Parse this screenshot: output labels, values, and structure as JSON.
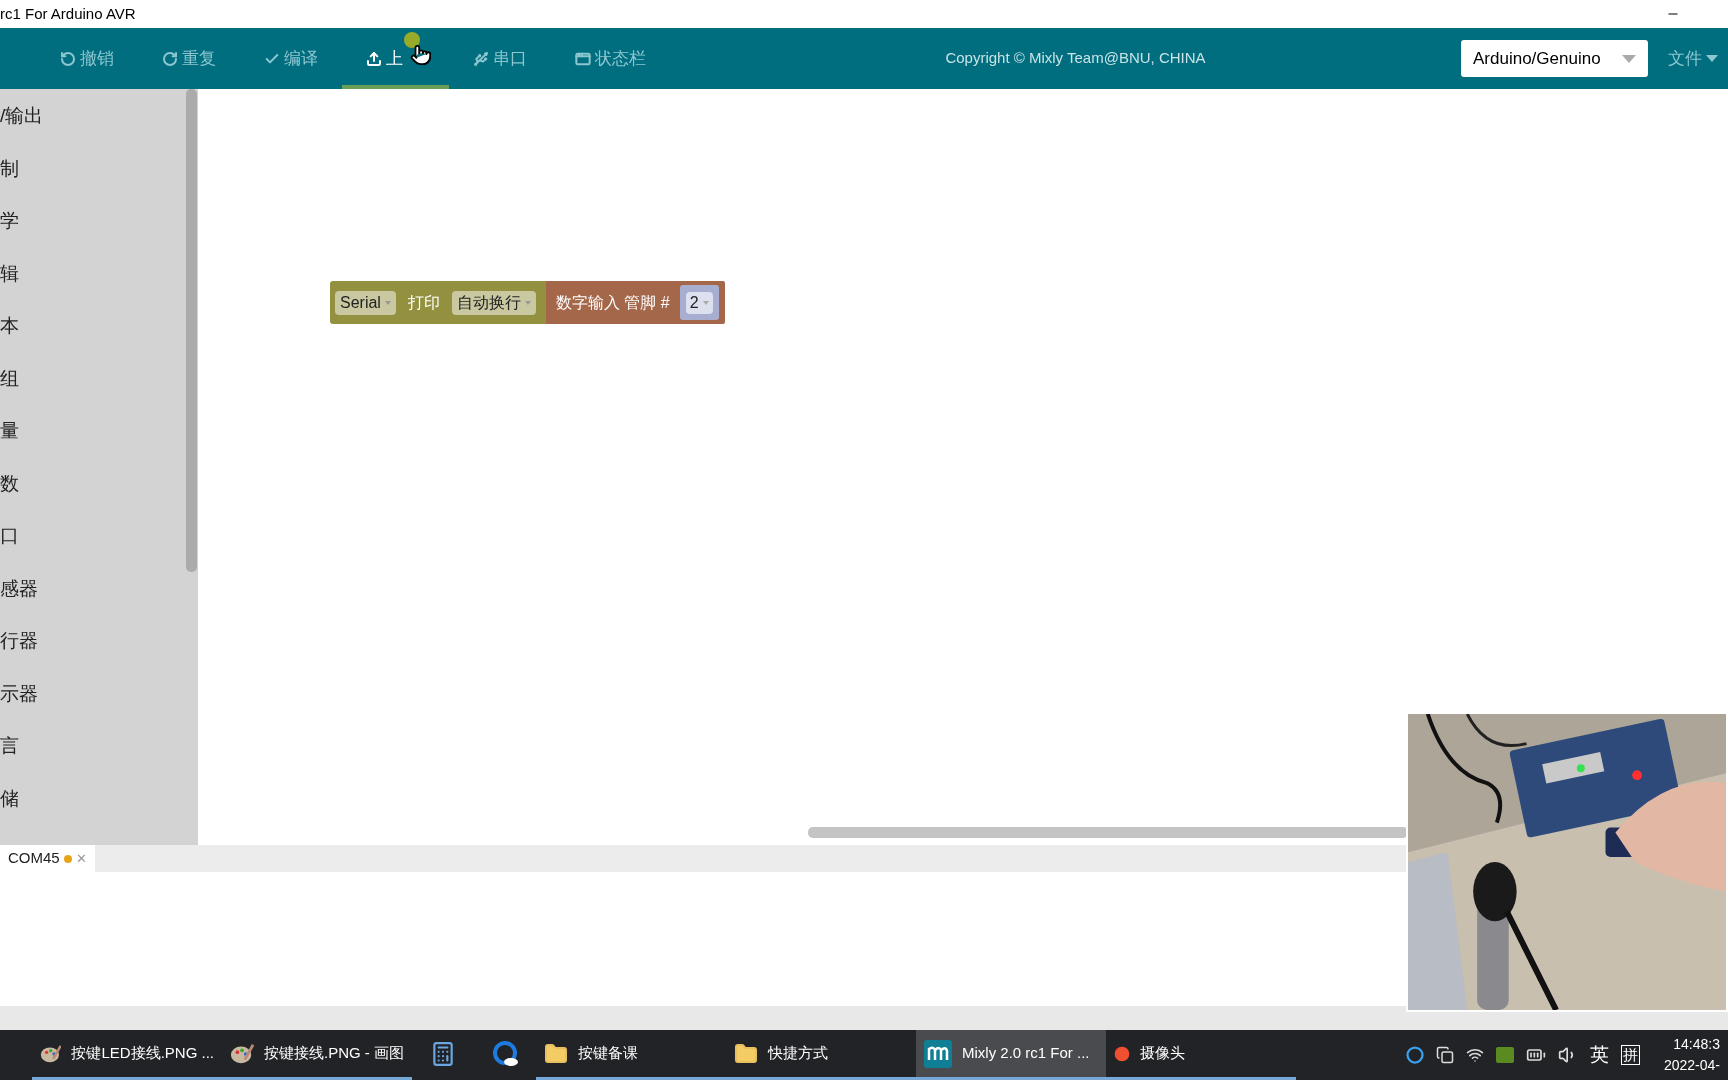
{
  "window": {
    "title": "rc1 For Arduino AVR"
  },
  "toolbar": {
    "items": [
      {
        "kind": "undo",
        "label": "撤销",
        "selected": false
      },
      {
        "kind": "redo",
        "label": "重复",
        "selected": false
      },
      {
        "kind": "compile",
        "label": "编译",
        "selected": false
      },
      {
        "kind": "upload",
        "label": "上",
        "selected": true
      },
      {
        "kind": "serial",
        "label": "串口",
        "selected": false
      },
      {
        "kind": "statusbar",
        "label": "状态栏",
        "selected": false
      }
    ],
    "copyright": "Copyright © Mixly Team@BNU, CHINA",
    "board_select": {
      "value": "Arduino/Genuino"
    },
    "file_menu": "文件"
  },
  "sidebar": {
    "items": [
      "/输出",
      "制",
      "学",
      "辑",
      "本",
      "组",
      "量",
      "数",
      "口",
      "感器",
      "行器",
      "示器",
      "言",
      "储"
    ]
  },
  "block": {
    "serial": "Serial",
    "print": "打印",
    "mode": "自动换行",
    "input": "数字输入 管脚 #",
    "pin": "2"
  },
  "serial_tabs": [
    {
      "label": "COM45",
      "selected": true,
      "color": "#e8a317",
      "close": "✕"
    }
  ],
  "taskbar": {
    "items": [
      {
        "kind": "paint",
        "label": "按键LED接线.PNG ...",
        "open": true,
        "selected": false
      },
      {
        "kind": "paint",
        "label": "按键接线.PNG - 画图",
        "open": true,
        "selected": false
      },
      {
        "kind": "calculator",
        "open": false,
        "selected": false
      },
      {
        "kind": "browser",
        "open": false,
        "selected": false
      },
      {
        "kind": "folder",
        "label": "按键备课",
        "open": true,
        "selected": false
      },
      {
        "kind": "folder",
        "label": "快捷方式",
        "open": true,
        "selected": false
      },
      {
        "kind": "mixly",
        "label": "Mixly 2.0 rc1 For ...",
        "open": true,
        "selected": true
      },
      {
        "kind": "record",
        "label": "摄像头",
        "open": true,
        "selected": false
      }
    ],
    "ime": "英",
    "ime_mode": "拼",
    "time": "14:48:3",
    "date": "2022-04-"
  }
}
